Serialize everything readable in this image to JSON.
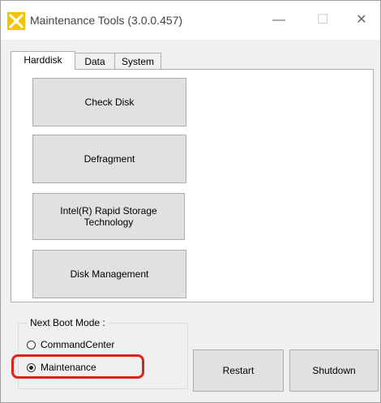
{
  "window": {
    "title": "Maintenance Tools (3.0.0.457)",
    "icon": "maintenance-tools-app-icon",
    "controls": {
      "minimize": "—",
      "maximize": "☐",
      "close": "✕"
    }
  },
  "tabs": [
    {
      "label": "Harddisk",
      "active": true
    },
    {
      "label": "Data",
      "active": false
    },
    {
      "label": "System",
      "active": false
    }
  ],
  "harddisk": {
    "buttons": [
      {
        "label": "Check Disk"
      },
      {
        "label": "Defragment"
      },
      {
        "label": "Intel(R) Rapid Storage Technology"
      },
      {
        "label": "Disk Management"
      }
    ]
  },
  "boot_mode": {
    "legend": "Next Boot Mode :",
    "options": [
      {
        "label": "CommandCenter",
        "selected": false
      },
      {
        "label": "Maintenance",
        "selected": true
      }
    ]
  },
  "actions": {
    "restart": "Restart",
    "shutdown": "Shutdown"
  },
  "colors": {
    "highlight": "#e0201a",
    "icon_yellow": "#f5c400"
  }
}
